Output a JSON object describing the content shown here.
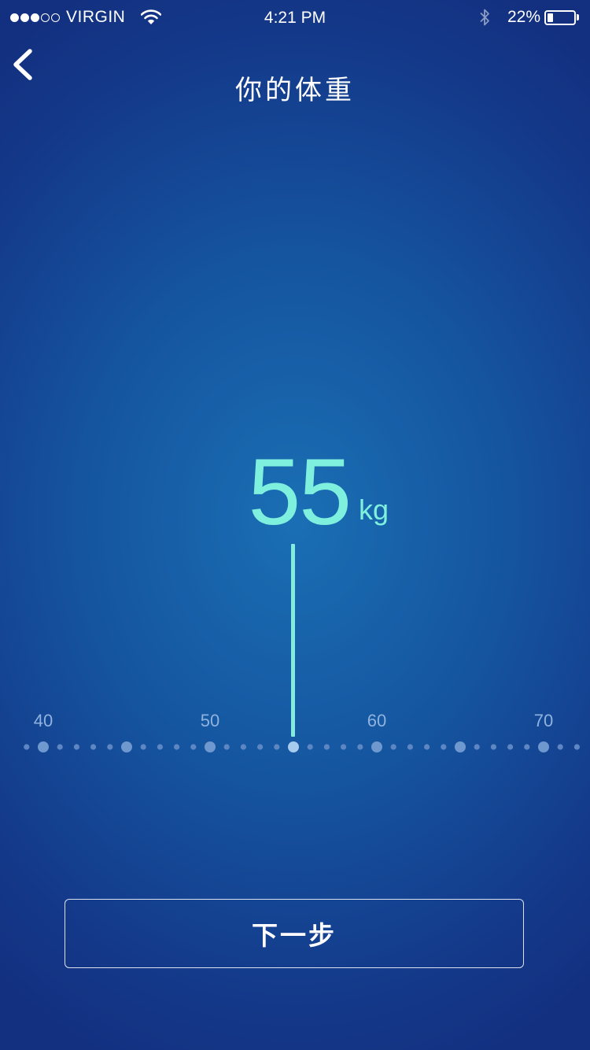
{
  "status_bar": {
    "signal_filled": 3,
    "signal_total": 5,
    "carrier": "VIRGIN",
    "time": "4:21 PM",
    "battery_percent": "22%",
    "battery_level": 0.22,
    "icons": [
      "wifi-icon",
      "bluetooth-icon",
      "battery-icon"
    ]
  },
  "nav": {
    "back_icon": "chevron-left-icon",
    "title": "你的体重"
  },
  "weight": {
    "value": "55",
    "unit": "kg",
    "color": "#7ff0dd"
  },
  "ruler": {
    "min": 39,
    "max": 72,
    "selected": 55,
    "major_step": 5,
    "labels": [
      {
        "value": 40,
        "text": "40"
      },
      {
        "value": 50,
        "text": "50"
      },
      {
        "value": 60,
        "text": "60"
      },
      {
        "value": 70,
        "text": "70"
      }
    ]
  },
  "footer": {
    "next_label": "下一步"
  },
  "colors": {
    "background_center": "#1a6fb4",
    "background_edge": "#132f7f",
    "accent": "#7ff0dd",
    "ruler_label": "#8fb3de"
  }
}
